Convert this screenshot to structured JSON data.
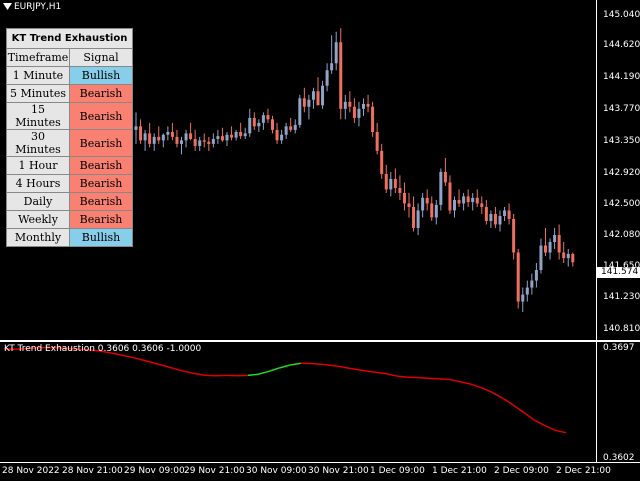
{
  "symbol": "EURJPY,H1",
  "indicator_label": "KT Trend Exhaustion 0.3606 0.3606 -1.0000",
  "panel": {
    "title": "KT Trend Exhaustion",
    "col_timeframe": "Timeframe",
    "col_signal": "Signal",
    "rows": [
      {
        "tf": "1 Minute",
        "sig": "Bullish"
      },
      {
        "tf": "5 Minutes",
        "sig": "Bearish"
      },
      {
        "tf": "15 Minutes",
        "sig": "Bearish"
      },
      {
        "tf": "30 Minutes",
        "sig": "Bearish"
      },
      {
        "tf": "1 Hour",
        "sig": "Bearish"
      },
      {
        "tf": "4 Hours",
        "sig": "Bearish"
      },
      {
        "tf": "Daily",
        "sig": "Bearish"
      },
      {
        "tf": "Weekly",
        "sig": "Bearish"
      },
      {
        "tf": "Monthly",
        "sig": "Bullish"
      }
    ]
  },
  "colors": {
    "bull": "#8fa4c8",
    "bear": "#f07060",
    "ind_down": "#e00000",
    "ind_up": "#22dd22"
  },
  "price_axis": [
    "145.040",
    "144.620",
    "144.190",
    "143.770",
    "143.350",
    "142.920",
    "142.500",
    "142.080",
    "141.650",
    "141.230",
    "140.810"
  ],
  "current_price": "141.574",
  "ind_axis": [
    "0.3697",
    "0.3602"
  ],
  "time_axis": [
    "28 Nov 2022",
    "28 Nov 21:00",
    "29 Nov 09:00",
    "29 Nov 21:00",
    "30 Nov 09:00",
    "30 Nov 21:00",
    "1 Dec 09:00",
    "1 Dec 21:00",
    "2 Dec 09:00",
    "2 Dec 21:00"
  ],
  "chart_data": {
    "type": "candlestick",
    "ylim": [
      140.68,
      145.16
    ],
    "candles": [
      [
        143.45,
        143.7,
        143.25,
        143.5
      ],
      [
        143.5,
        143.6,
        143.25,
        143.3
      ],
      [
        143.3,
        143.45,
        143.15,
        143.4
      ],
      [
        143.4,
        143.55,
        143.2,
        143.25
      ],
      [
        143.25,
        143.4,
        143.15,
        143.35
      ],
      [
        143.35,
        143.5,
        143.25,
        143.3
      ],
      [
        143.3,
        143.4,
        143.2,
        143.38
      ],
      [
        143.38,
        143.5,
        143.3,
        143.42
      ],
      [
        143.42,
        143.55,
        143.3,
        143.35
      ],
      [
        143.35,
        143.45,
        143.2,
        143.25
      ],
      [
        143.25,
        143.35,
        143.1,
        143.3
      ],
      [
        143.3,
        143.45,
        143.2,
        143.4
      ],
      [
        143.4,
        143.55,
        143.3,
        143.32
      ],
      [
        143.32,
        143.45,
        143.15,
        143.22
      ],
      [
        143.22,
        143.35,
        143.15,
        143.3
      ],
      [
        143.3,
        143.4,
        143.2,
        143.28
      ],
      [
        143.28,
        143.35,
        143.15,
        143.25
      ],
      [
        143.25,
        143.4,
        143.2,
        143.32
      ],
      [
        143.32,
        143.45,
        143.25,
        143.36
      ],
      [
        143.36,
        143.48,
        143.28,
        143.3
      ],
      [
        143.3,
        143.42,
        143.22,
        143.38
      ],
      [
        143.38,
        143.5,
        143.3,
        143.34
      ],
      [
        143.34,
        143.45,
        143.3,
        143.42
      ],
      [
        143.42,
        143.55,
        143.32,
        143.36
      ],
      [
        143.36,
        143.48,
        143.32,
        143.4
      ],
      [
        143.4,
        143.75,
        143.35,
        143.62
      ],
      [
        143.62,
        143.7,
        143.45,
        143.5
      ],
      [
        143.5,
        143.6,
        143.42,
        143.55
      ],
      [
        143.55,
        143.7,
        143.45,
        143.66
      ],
      [
        143.66,
        143.75,
        143.55,
        143.6
      ],
      [
        143.6,
        143.65,
        143.4,
        143.45
      ],
      [
        143.45,
        143.55,
        143.25,
        143.3
      ],
      [
        143.3,
        143.45,
        143.25,
        143.38
      ],
      [
        143.38,
        143.55,
        143.32,
        143.5
      ],
      [
        143.5,
        143.62,
        143.42,
        143.45
      ],
      [
        143.45,
        143.6,
        143.4,
        143.52
      ],
      [
        143.52,
        143.95,
        143.48,
        143.9
      ],
      [
        143.9,
        144.05,
        143.7,
        143.78
      ],
      [
        143.78,
        143.95,
        143.6,
        143.88
      ],
      [
        143.88,
        144.05,
        143.75,
        144
      ],
      [
        144,
        144.2,
        143.85,
        143.8
      ],
      [
        143.8,
        144.15,
        143.75,
        144.08
      ],
      [
        144.08,
        144.4,
        144,
        144.3
      ],
      [
        144.3,
        144.8,
        144.25,
        144.4
      ],
      [
        144.4,
        144.85,
        144.3,
        144.7
      ],
      [
        144.7,
        144.9,
        143.6,
        143.75
      ],
      [
        143.75,
        143.95,
        143.6,
        143.85
      ],
      [
        143.85,
        144,
        143.7,
        143.78
      ],
      [
        143.78,
        143.9,
        143.55,
        143.62
      ],
      [
        143.62,
        143.85,
        143.5,
        143.75
      ],
      [
        143.75,
        143.9,
        143.65,
        143.82
      ],
      [
        143.82,
        143.95,
        143.7,
        143.78
      ],
      [
        143.78,
        143.85,
        143.35,
        143.42
      ],
      [
        143.42,
        143.55,
        143.1,
        143.15
      ],
      [
        143.15,
        143.25,
        142.75,
        142.82
      ],
      [
        142.82,
        142.95,
        142.55,
        142.6
      ],
      [
        142.6,
        142.85,
        142.5,
        142.75
      ],
      [
        142.75,
        142.9,
        142.55,
        142.62
      ],
      [
        142.62,
        142.8,
        142.45,
        142.55
      ],
      [
        142.55,
        142.7,
        142.3,
        142.4
      ],
      [
        142.4,
        142.55,
        142.2,
        142.35
      ],
      [
        142.35,
        142.5,
        142,
        142.05
      ],
      [
        142.05,
        142.4,
        141.95,
        142.3
      ],
      [
        142.3,
        142.55,
        142.2,
        142.48
      ],
      [
        142.48,
        142.6,
        142.3,
        142.4
      ],
      [
        142.4,
        142.5,
        142.15,
        142.2
      ],
      [
        142.2,
        142.45,
        142.1,
        142.38
      ],
      [
        142.38,
        142.9,
        142.3,
        142.85
      ],
      [
        142.85,
        143.05,
        142.65,
        142.7
      ],
      [
        142.7,
        142.8,
        142.25,
        142.3
      ],
      [
        142.3,
        142.5,
        142.2,
        142.45
      ],
      [
        142.45,
        142.6,
        142.35,
        142.4
      ],
      [
        142.4,
        142.55,
        142.3,
        142.5
      ],
      [
        142.5,
        142.6,
        142.35,
        142.42
      ],
      [
        142.42,
        142.55,
        142.3,
        142.48
      ],
      [
        142.48,
        142.6,
        142.35,
        142.4
      ],
      [
        142.4,
        142.5,
        142.25,
        142.35
      ],
      [
        142.35,
        142.45,
        142.1,
        142.15
      ],
      [
        142.15,
        142.3,
        142.05,
        142.25
      ],
      [
        142.25,
        142.35,
        142.05,
        142.1
      ],
      [
        142.1,
        142.3,
        142,
        142.22
      ],
      [
        142.22,
        142.35,
        142.15,
        142.3
      ],
      [
        142.3,
        142.4,
        142.1,
        142.18
      ],
      [
        142.18,
        142.25,
        141.6,
        141.7
      ],
      [
        141.7,
        141.75,
        140.9,
        141
      ],
      [
        141,
        141.2,
        140.85,
        141.1
      ],
      [
        141.1,
        141.3,
        141,
        141.2
      ],
      [
        141.2,
        141.4,
        141.1,
        141.3
      ],
      [
        141.3,
        141.55,
        141.2,
        141.45
      ],
      [
        141.45,
        141.9,
        141.4,
        141.8
      ],
      [
        141.8,
        142.05,
        141.65,
        141.7
      ],
      [
        141.7,
        141.9,
        141.6,
        141.85
      ],
      [
        141.85,
        142.05,
        141.75,
        141.95
      ],
      [
        141.95,
        142.1,
        141.6,
        141.7
      ],
      [
        141.7,
        141.85,
        141.55,
        141.62
      ],
      [
        141.62,
        141.75,
        141.5,
        141.68
      ],
      [
        141.68,
        141.7,
        141.5,
        141.56
      ]
    ],
    "indicator": [
      0.36955,
      0.3695,
      0.36955,
      0.36962,
      0.36965,
      0.36963,
      0.36958,
      0.36952,
      0.36945,
      0.36935,
      0.3692,
      0.36902,
      0.36882,
      0.3686,
      0.36835,
      0.3681,
      0.36785,
      0.3676,
      0.3674,
      0.36725,
      0.36722,
      0.36725,
      0.36722,
      0.36725,
      0.36735,
      0.3676,
      0.3679,
      0.36815,
      0.3683,
      0.36828,
      0.3682,
      0.3681,
      0.36795,
      0.3678,
      0.36765,
      0.36752,
      0.3674,
      0.3672,
      0.3671,
      0.36705,
      0.367,
      0.36695,
      0.3669,
      0.3667,
      0.3665,
      0.3662,
      0.3658,
      0.3653,
      0.3647,
      0.36405,
      0.3634,
      0.3629,
      0.3625,
      0.3623
    ]
  }
}
